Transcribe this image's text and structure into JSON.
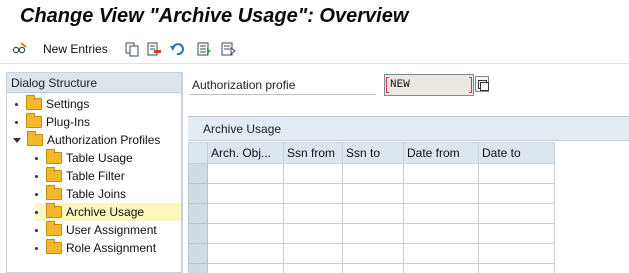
{
  "title": "Change View \"Archive Usage\": Overview",
  "toolbar": {
    "new_entries_label": "New Entries",
    "icons": [
      "glasses-edit-icon",
      "copy-icon",
      "delete-icon",
      "undo-icon",
      "select-all-icon",
      "deselect-icon"
    ]
  },
  "dialog_structure": {
    "header": "Dialog Structure",
    "items": [
      {
        "label": "Settings",
        "level": 0,
        "expanded": false,
        "selected": false
      },
      {
        "label": "Plug-Ins",
        "level": 0,
        "expanded": false,
        "selected": false
      },
      {
        "label": "Authorization Profiles",
        "level": 0,
        "expanded": true,
        "selected": false
      },
      {
        "label": "Table Usage",
        "level": 1,
        "expanded": false,
        "selected": false
      },
      {
        "label": "Table Filter",
        "level": 1,
        "expanded": false,
        "selected": false
      },
      {
        "label": "Table Joins",
        "level": 1,
        "expanded": false,
        "selected": false
      },
      {
        "label": "Archive Usage",
        "level": 1,
        "expanded": false,
        "selected": true
      },
      {
        "label": "User Assignment",
        "level": 1,
        "expanded": false,
        "selected": false
      },
      {
        "label": "Role Assignment",
        "level": 1,
        "expanded": false,
        "selected": false
      }
    ]
  },
  "auth": {
    "label": "Authorization profie",
    "value": "NEW"
  },
  "table": {
    "title": "Archive Usage",
    "columns": [
      "Arch. Obj...",
      "Ssn from",
      "Ssn to",
      "Date from",
      "Date to"
    ],
    "rows": [
      [
        "",
        "",
        "",
        "",
        ""
      ],
      [
        "",
        "",
        "",
        "",
        ""
      ],
      [
        "",
        "",
        "",
        "",
        ""
      ],
      [
        "",
        "",
        "",
        "",
        ""
      ],
      [
        "",
        "",
        "",
        "",
        ""
      ],
      [
        "",
        "",
        "",
        "",
        ""
      ]
    ]
  },
  "colors": {
    "header_bg": "#dce4ec",
    "selected_bg": "#fcf6bf",
    "folder": "#f3b92a"
  }
}
